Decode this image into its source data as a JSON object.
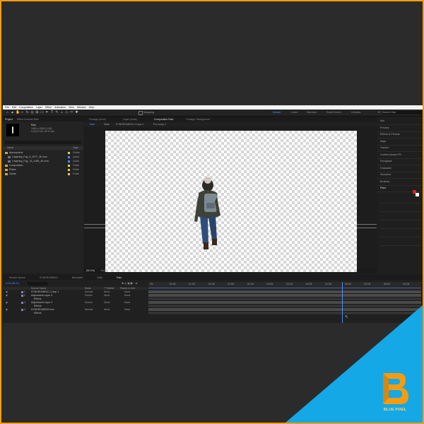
{
  "menu": [
    "File",
    "Edit",
    "Composition",
    "Layer",
    "Effect",
    "Animation",
    "View",
    "Window",
    "Help"
  ],
  "toolbar": {
    "snapping": "Snapping",
    "workspaces": [
      "Default",
      "Learn",
      "Standard",
      "Small Screen",
      "Libraries"
    ],
    "active_workspace": "Default",
    "search_placeholder": "Search Help"
  },
  "project": {
    "tabs": [
      "Project",
      "Effect Controls Rain"
    ],
    "item_name": "Rain",
    "item_meta": [
      "1000 x 1080 (1.00)",
      "0;00;07;00, 29.97 fps"
    ],
    "search_placeholder": "",
    "columns": [
      "Name",
      "Type"
    ],
    "items": [
      {
        "name": "Atmospheric",
        "type": "Folder",
        "color": "#e8d25a",
        "indent": 0
      },
      {
        "name": "Lingering_Fog_5_1077_4K.mov",
        "type": "Quick",
        "color": "#4d8ef7",
        "indent": 1
      },
      {
        "name": "Lingering_Fog_7A_1080_4K.mov",
        "type": "Quick",
        "color": "#4d8ef7",
        "indent": 1
      },
      {
        "name": "Composition",
        "type": "Folde",
        "color": "#e8d25a",
        "indent": 0
      },
      {
        "name": "Plates",
        "type": "Folde",
        "color": "#e8d25a",
        "indent": 0
      },
      {
        "name": "Solids",
        "type": "Folde",
        "color": "#e8d25a",
        "indent": 0
      }
    ]
  },
  "viewer": {
    "tabs": [
      "Footage (none)",
      "Layer (none)",
      "Composition Rain",
      "Footage: Background"
    ],
    "active_tab": "Composition Rain",
    "breadcrumbs": [
      "Rain",
      "Walk",
      "SYNDROME001 Comp 1",
      "Pre-comp 1"
    ],
    "zoom": "(50.0%)",
    "quality": "Full",
    "timecode": "00;00;08;13",
    "exposure": "+0.0"
  },
  "right_panel": {
    "items": [
      "Info",
      "Preview",
      "Effects & Presets",
      "Align",
      "Tracker",
      "Content-Aware Fill",
      "Paragraph",
      "Character",
      "Smoother",
      "Brushes",
      "Paint"
    ],
    "paint": {
      "fg_color": "#e02020",
      "bg_color": "#ffffff"
    }
  },
  "timeline": {
    "tabs": [
      "Render Queue",
      "SYNDROME001",
      "Backplate",
      "Walk",
      "Rain"
    ],
    "active_tab": "Rain",
    "timecode": "0;00;08;13",
    "columns": [
      "Source Name",
      "Mode",
      "T TrkMat",
      "Parent & Link"
    ],
    "layers": [
      {
        "num": "1",
        "name": "SYNDROME001 Comp 1",
        "mode": "Normal",
        "trkmat": "None",
        "parent": "None"
      },
      {
        "num": "2",
        "name": "Adjustment Layer 3",
        "mode": "Screen",
        "trkmat": "None",
        "parent": "None"
      },
      {
        "num": "",
        "name": "Effects",
        "mode": "",
        "trkmat": "",
        "parent": ""
      },
      {
        "num": "3",
        "name": "Adjustment Layer 2",
        "mode": "Screen",
        "trkmat": "None",
        "parent": "None"
      },
      {
        "num": "",
        "name": "Effects",
        "mode": "",
        "trkmat": "",
        "parent": ""
      },
      {
        "num": "4",
        "name": "SYNDROME002.bon",
        "mode": "Normal",
        "trkmat": "None",
        "parent": "None"
      },
      {
        "num": "",
        "name": "Effects",
        "mode": "",
        "trkmat": "",
        "parent": ""
      }
    ],
    "ruler": [
      "00f",
      "00:15f",
      "01:00f",
      "01:15f",
      "02:00f",
      "02:15f",
      "03:00f",
      "03:15f",
      "04:00f",
      "04:15f",
      "05:00f",
      "05:15f",
      "06:00f",
      "06:15f"
    ],
    "playhead_fraction": 0.71
  },
  "logo": {
    "text": "BLUE PIXEL",
    "letter": "B"
  }
}
